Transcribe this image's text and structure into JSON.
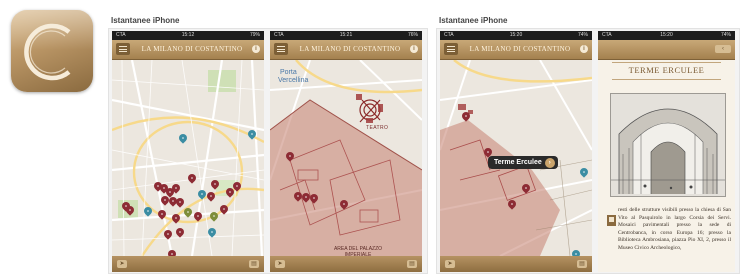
{
  "app_icon": {
    "name": "app-logo-c",
    "colors": {
      "gold_light": "#d9b98a",
      "gold_dark": "#8a6a3f"
    }
  },
  "sections": [
    {
      "title": "Istantanee iPhone"
    },
    {
      "title": "Istantanee iPhone"
    }
  ],
  "screens": [
    {
      "status": {
        "carrier": "CTA",
        "time": "15:12",
        "battery": "79%"
      },
      "nav_title": "LA MILANO DI COSTANTINO",
      "pin_colors": {
        "red": "#8d2b34",
        "teal": "#3b8da3",
        "olive": "#7d8d3a"
      }
    },
    {
      "status": {
        "carrier": "CTA",
        "time": "15:21",
        "battery": "76%"
      },
      "nav_title": "LA MILANO DI COSTANTINO",
      "map_labels": {
        "porta": "Porta",
        "vercellina": "Vercellina",
        "teatro": "TEATRO",
        "area_label": "AREA DEL PALAZZO IMPERIALE"
      }
    },
    {
      "status": {
        "carrier": "CTA",
        "time": "15:20",
        "battery": "74%"
      },
      "nav_title": "LA MILANO DI COSTANTINO",
      "callout": "Terme Erculee"
    },
    {
      "status": {
        "carrier": "CTA",
        "time": "15:20",
        "battery": "74%"
      },
      "title": "TERME ERCULEE",
      "body": "resti delle strutture visibili presso la chiesa di San Vito al Pasquirolo in largo Corsia dei Servi. Mosaici pavimentali presso la sede di Centrobanca, in corso Europa 16; presso la Biblioteca Ambrosiana, piazza Pio XI, 2, presso il Museo Civico Archeologico,"
    }
  ]
}
